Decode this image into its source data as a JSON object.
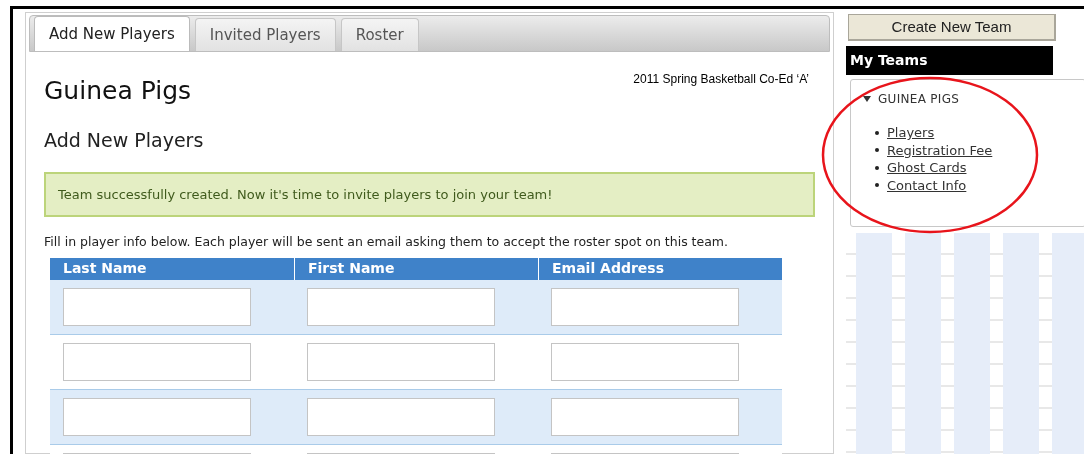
{
  "tabs": [
    {
      "label": "Add New Players",
      "selected": true
    },
    {
      "label": "Invited Players",
      "selected": false
    },
    {
      "label": "Roster",
      "selected": false
    }
  ],
  "team_name": "Guinea Pigs",
  "league": "2011 Spring Basketball Co-Ed ‘A’",
  "section_title": "Add New Players",
  "success_message": "Team successfully created. Now it's time to invite players to join your team!",
  "instructions": "Fill in player info below. Each player will be sent an email asking them to accept the roster spot on this team.",
  "table": {
    "columns": [
      "Last Name",
      "First Name",
      "Email Address"
    ],
    "rows": [
      {
        "shaded": true
      },
      {
        "shaded": false
      },
      {
        "shaded": true
      },
      {
        "shaded": false
      }
    ]
  },
  "sidebar": {
    "button": "Create New Team",
    "heading": "My Teams",
    "team": {
      "name": "GUINEA PIGS",
      "expanded": true,
      "links": [
        "Players",
        "Registration Fee",
        "Ghost Cards",
        "Contact Info"
      ]
    }
  }
}
